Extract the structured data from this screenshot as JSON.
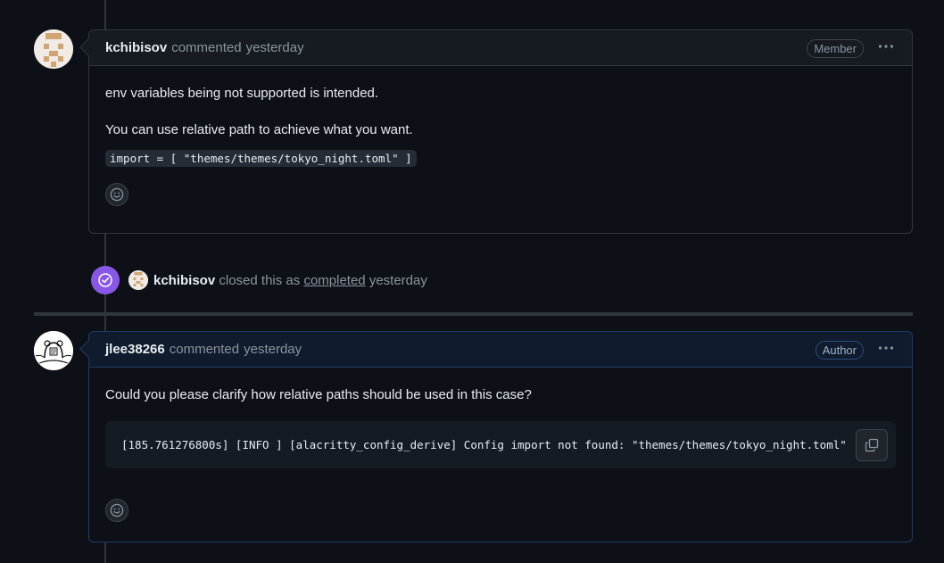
{
  "comments": [
    {
      "author": "kchibisov",
      "action": "commented",
      "time": "yesterday",
      "role": "Member",
      "paragraphs": [
        "env variables being not supported is intended.",
        "You can use relative path to achieve what you want."
      ],
      "code": "import = [ \"themes/themes/tokyo_night.toml\" ]"
    },
    {
      "author": "jlee38266",
      "action": "commented",
      "time": "yesterday",
      "role": "Author",
      "paragraphs": [
        "Could you please clarify how relative paths should be used in this case?"
      ],
      "code": "[185.761276800s] [INFO ] [alacritty_config_derive] Config import not found: \"themes/themes/tokyo_night.toml\""
    }
  ],
  "event": {
    "actor": "kchibisov",
    "text_before": "closed this as",
    "state": "completed",
    "time": "yesterday"
  },
  "icons": {
    "more": "kebab-horizontal-icon",
    "reaction": "smiley-icon",
    "copy": "copy-icon",
    "closed": "check-circle-icon"
  },
  "colors": {
    "background": "#0d1117",
    "closed_badge": "#8957e5",
    "author_border": "#1f3b66"
  }
}
